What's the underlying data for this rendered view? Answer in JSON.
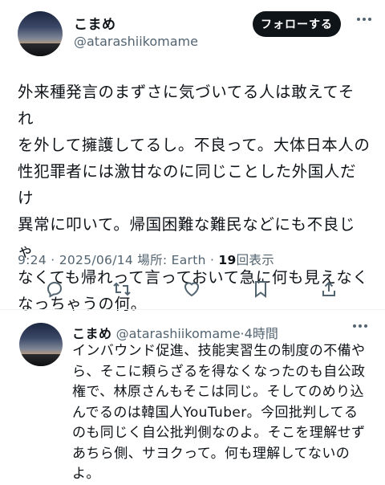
{
  "tweet": {
    "display_name": "こまめ",
    "handle": "@atarashiikomame",
    "follow_label": "フォローする",
    "text": "外来種発言のまずさに気づいてる人は敢えてそれ\nを外して擁護してるし。不良って。大体日本人の\n性犯罪者には激甘なのに同じことした外国人だけ\n異常に叩いて。帰国困難な難民などにも不良じゃ\nなくても帰れって言っておいて急に何も見えなく\nなっちゃうの何。",
    "time": "9:24",
    "date": "2025/06/14",
    "location": "場所: Earth",
    "views_count": "19",
    "views_label": "回表示",
    "separator": "·"
  },
  "reply": {
    "display_name": "こまめ",
    "handle": "@atarashiikomame",
    "age": "4時間",
    "text": "インバウンド促進、技能実習生の制度の不備や\nら、そこに頼らざるを得なくなったのも自公政\n権で、林原さんもそこは同じ。そしてのめり込\nんでるのは韓国人YouTuber。今回批判してる\nのも同じく自公批判側なのよ。そこを理解せず\nあちら側、サヨクって。何も理解してないの\nよ。"
  },
  "icons": [
    "reply-icon",
    "retweet-icon",
    "like-icon",
    "bookmark-icon",
    "share-icon",
    "more-icon"
  ],
  "colors": {
    "text": "#0f1419",
    "secondary": "#536471",
    "button_bg": "#0f1419",
    "divider": "#eff3f4"
  }
}
